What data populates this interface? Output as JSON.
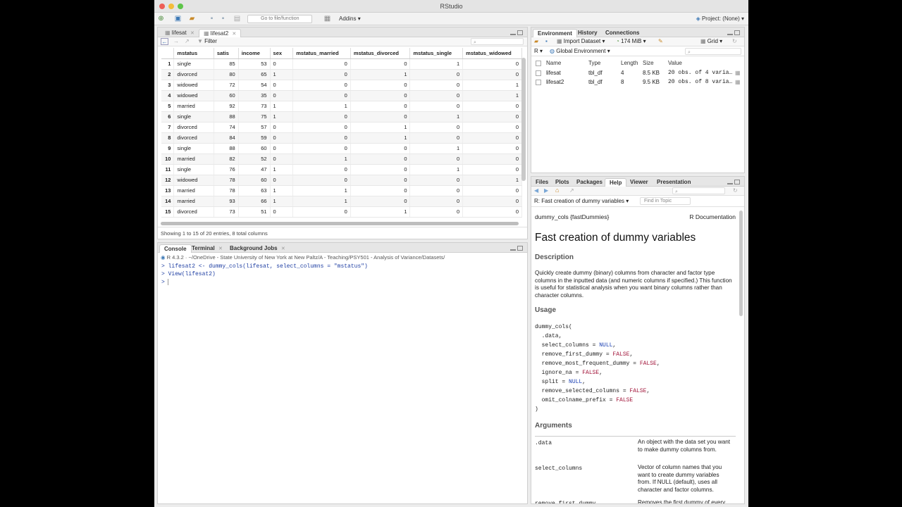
{
  "window": {
    "title": "RStudio"
  },
  "toolbar": {
    "goto_placeholder": "Go to file/function",
    "addins": "Addins",
    "project": "Project: (None)"
  },
  "source": {
    "tabs": [
      {
        "label": "lifesat"
      },
      {
        "label": "lifesat2"
      }
    ],
    "filter_label": "Filter",
    "columns": [
      "mstatus",
      "satis",
      "income",
      "sex",
      "mstatus_married",
      "mstatus_divorced",
      "mstatus_single",
      "mstatus_widowed"
    ],
    "rows": [
      [
        "1",
        "single",
        "85",
        "53",
        "0",
        "0",
        "0",
        "1",
        "0"
      ],
      [
        "2",
        "divorced",
        "80",
        "65",
        "1",
        "0",
        "1",
        "0",
        "0"
      ],
      [
        "3",
        "widowed",
        "72",
        "54",
        "0",
        "0",
        "0",
        "0",
        "1"
      ],
      [
        "4",
        "widowed",
        "60",
        "35",
        "0",
        "0",
        "0",
        "0",
        "1"
      ],
      [
        "5",
        "married",
        "92",
        "73",
        "1",
        "1",
        "0",
        "0",
        "0"
      ],
      [
        "6",
        "single",
        "88",
        "75",
        "1",
        "0",
        "0",
        "1",
        "0"
      ],
      [
        "7",
        "divorced",
        "74",
        "57",
        "0",
        "0",
        "1",
        "0",
        "0"
      ],
      [
        "8",
        "divorced",
        "84",
        "59",
        "0",
        "0",
        "1",
        "0",
        "0"
      ],
      [
        "9",
        "single",
        "88",
        "60",
        "0",
        "0",
        "0",
        "1",
        "0"
      ],
      [
        "10",
        "married",
        "82",
        "52",
        "0",
        "1",
        "0",
        "0",
        "0"
      ],
      [
        "11",
        "single",
        "76",
        "47",
        "1",
        "0",
        "0",
        "1",
        "0"
      ],
      [
        "12",
        "widowed",
        "78",
        "60",
        "0",
        "0",
        "0",
        "0",
        "1"
      ],
      [
        "13",
        "married",
        "78",
        "63",
        "1",
        "1",
        "0",
        "0",
        "0"
      ],
      [
        "14",
        "married",
        "93",
        "66",
        "1",
        "1",
        "0",
        "0",
        "0"
      ],
      [
        "15",
        "divorced",
        "73",
        "51",
        "0",
        "0",
        "1",
        "0",
        "0"
      ]
    ],
    "status": "Showing 1 to 15 of 20 entries, 8 total columns"
  },
  "console": {
    "tabs": [
      {
        "label": "Console"
      },
      {
        "label": "Terminal"
      },
      {
        "label": "Background Jobs"
      }
    ],
    "path": "R 4.3.2 · ~/OneDrive - State University of New York at New Paltz/A - Teaching/PSY501 - Analysis of Variance/Datasets/",
    "lines": [
      "> lifesat2 <- dummy_cols(lifesat, select_columns = \"mstatus\")",
      "> View(lifesat2)",
      ">"
    ]
  },
  "env": {
    "tabs": [
      {
        "label": "Environment"
      },
      {
        "label": "History"
      },
      {
        "label": "Connections"
      }
    ],
    "import": "Import Dataset",
    "memory": "174 MiB",
    "view_mode": "Grid",
    "lang": "R",
    "scope": "Global Environment",
    "headers": [
      "Name",
      "Type",
      "Length",
      "Size",
      "Value"
    ],
    "rows": [
      [
        "lifesat",
        "tbl_df",
        "4",
        "8.5 KB",
        "20 obs. of 4 varia…"
      ],
      [
        "lifesat2",
        "tbl_df",
        "8",
        "9.5 KB",
        "20 obs. of 8 varia…"
      ]
    ]
  },
  "help": {
    "tabs": [
      {
        "label": "Files"
      },
      {
        "label": "Plots"
      },
      {
        "label": "Packages"
      },
      {
        "label": "Help"
      },
      {
        "label": "Viewer"
      },
      {
        "label": "Presentation"
      }
    ],
    "topic": "R: Fast creation of dummy variables",
    "find_placeholder": "Find in Topic",
    "pkg": "dummy_cols {fastDummies}",
    "rdoc": "R Documentation",
    "title": "Fast creation of dummy variables",
    "description_h": "Description",
    "description": "Quickly create dummy (binary) columns from character and factor type columns in the inputted data (and numeric columns if specified.) This function is useful for statistical analysis when you want binary columns rather than character columns.",
    "usage_h": "Usage",
    "arguments_h": "Arguments",
    "args": [
      {
        "name": ".data",
        "desc": "An object with the data set you want to make dummy columns from."
      },
      {
        "name": "select_columns",
        "desc": "Vector of column names that you want to create dummy variables from. If NULL (default), uses all character and factor columns."
      },
      {
        "name": "remove_first_dummy",
        "desc": "Removes the first dummy of every"
      }
    ]
  }
}
